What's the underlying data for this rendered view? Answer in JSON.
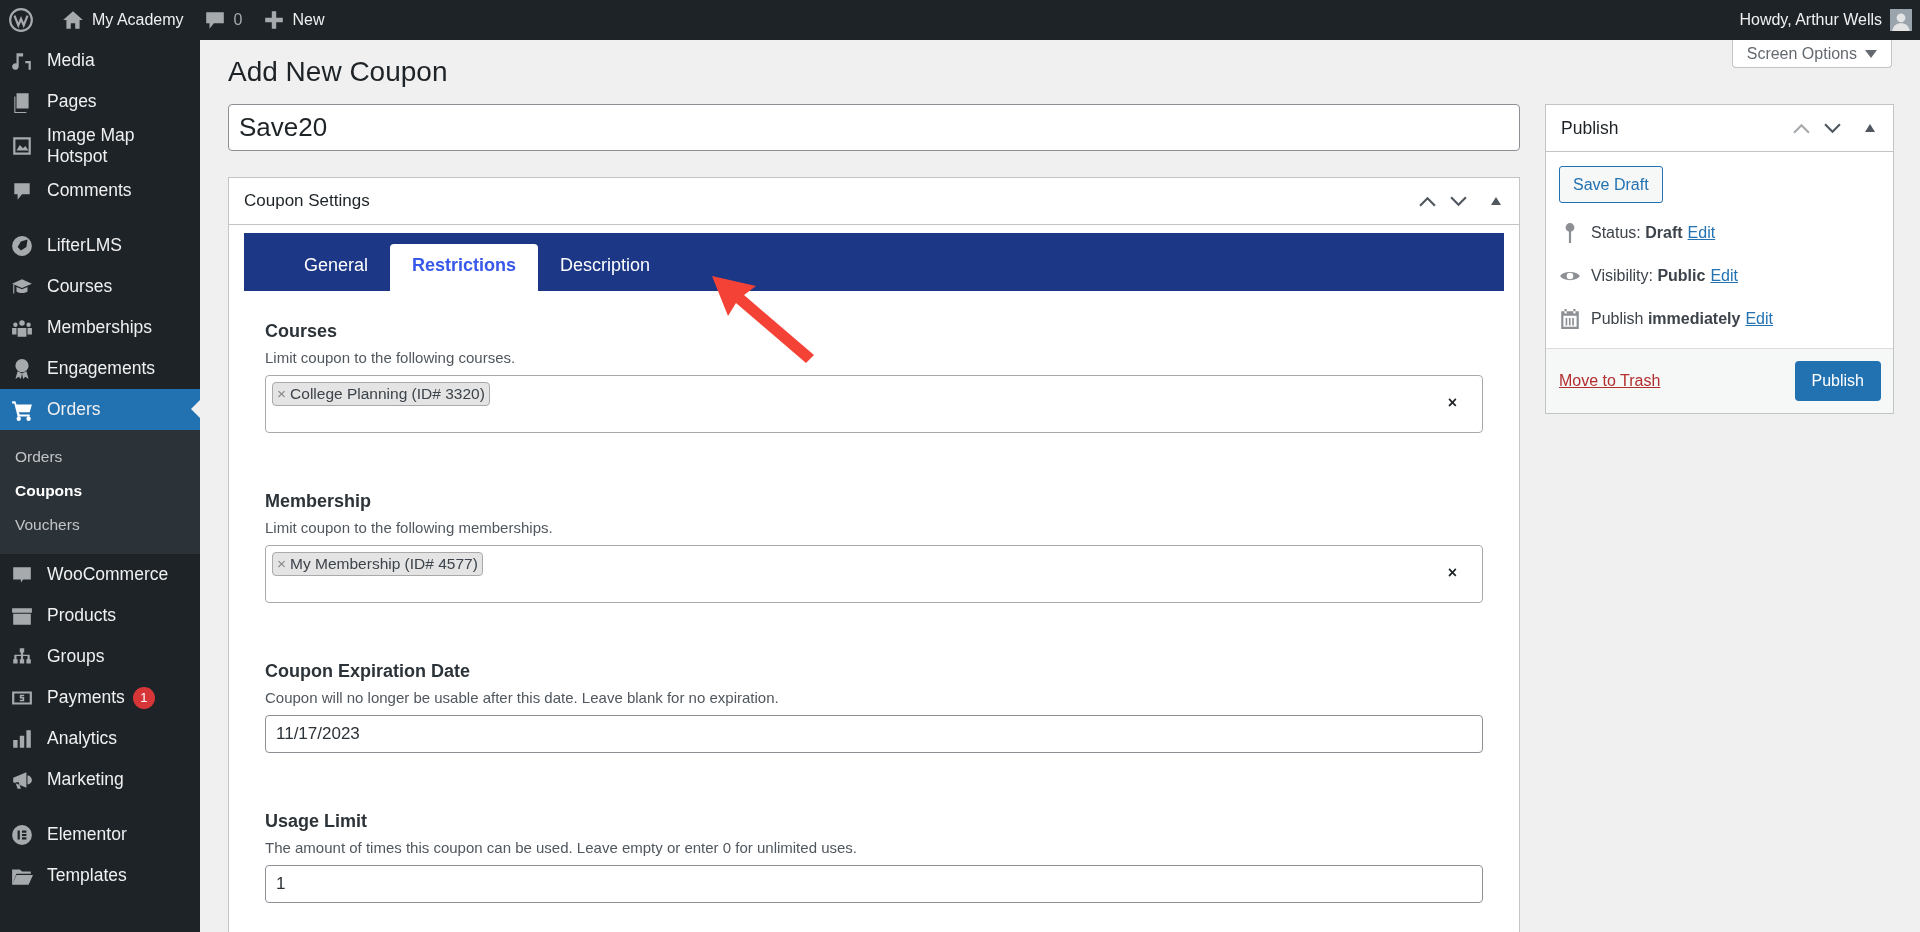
{
  "admin_bar": {
    "site_name": "My Academy",
    "comments_count": "0",
    "new_label": "New",
    "greeting": "Howdy, Arthur Wells"
  },
  "sidebar": {
    "groups": [
      {
        "items": [
          {
            "label": "Media",
            "current": false
          },
          {
            "label": "Pages",
            "current": false
          },
          {
            "label": "Image Map Hotspot",
            "current": false
          },
          {
            "label": "Comments",
            "current": false
          }
        ]
      },
      {
        "items": [
          {
            "label": "LifterLMS",
            "current": false
          },
          {
            "label": "Courses",
            "current": false
          },
          {
            "label": "Memberships",
            "current": false
          },
          {
            "label": "Engagements",
            "current": false
          },
          {
            "label": "Orders",
            "current": true,
            "children": [
              {
                "label": "Orders",
                "selected": false
              },
              {
                "label": "Coupons",
                "selected": true
              },
              {
                "label": "Vouchers",
                "selected": false
              }
            ]
          },
          {
            "label": "WooCommerce",
            "current": false
          },
          {
            "label": "Products",
            "current": false
          },
          {
            "label": "Groups",
            "current": false
          },
          {
            "label": "Payments",
            "current": false,
            "badge": "1"
          },
          {
            "label": "Analytics",
            "current": false
          },
          {
            "label": "Marketing",
            "current": false
          }
        ]
      },
      {
        "items": [
          {
            "label": "Elementor",
            "current": false
          },
          {
            "label": "Templates",
            "current": false
          }
        ]
      }
    ]
  },
  "screen_options": "Screen Options",
  "page_title": "Add New Coupon",
  "title_field": {
    "value": "Save20"
  },
  "coupon_settings": {
    "title": "Coupon Settings",
    "tabs": [
      {
        "label": "General",
        "selected": false
      },
      {
        "label": "Restrictions",
        "selected": true
      },
      {
        "label": "Description",
        "selected": false
      }
    ],
    "fields": [
      {
        "kind": "multiselect",
        "label": "Courses",
        "description": "Limit coupon to the following courses.",
        "chips": [
          {
            "remove": "×",
            "label": "College Planning (ID# 3320)"
          }
        ],
        "clear": "×"
      },
      {
        "kind": "multiselect",
        "label": "Membership",
        "description": "Limit coupon to the following memberships.",
        "chips": [
          {
            "remove": "×",
            "label": "My Membership (ID# 4577)"
          }
        ],
        "clear": "×"
      },
      {
        "kind": "text",
        "label": "Coupon Expiration Date",
        "description": "Coupon will no longer be usable after this date. Leave blank for no expiration.",
        "value": "11/17/2023"
      },
      {
        "kind": "text",
        "label": "Usage Limit",
        "description": "The amount of times this coupon can be used. Leave empty or enter 0 for unlimited uses.",
        "value": "1"
      }
    ]
  },
  "publish": {
    "title": "Publish",
    "save_draft": "Save Draft",
    "rows": [
      {
        "text": "Status: **Draft**",
        "link": "Edit"
      },
      {
        "text": "Visibility: **Public**",
        "link": "Edit"
      },
      {
        "text": "Publish **immediately**",
        "link": "Edit"
      }
    ],
    "trash": "Move to Trash",
    "publish_button": "Publish"
  }
}
